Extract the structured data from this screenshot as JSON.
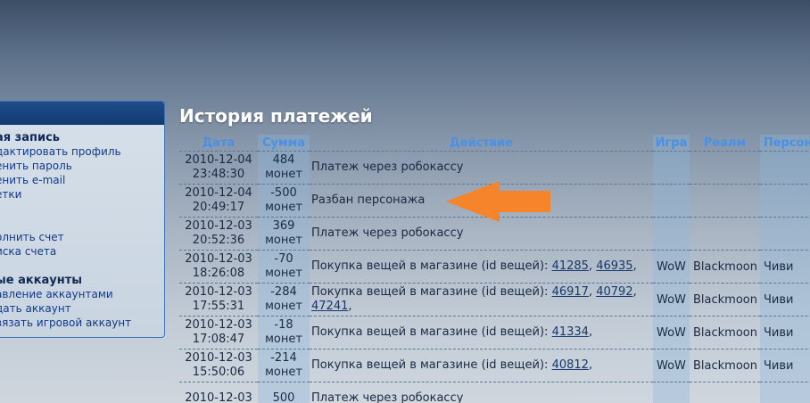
{
  "sidebar": {
    "sections": [
      {
        "title": "ая запись",
        "links": [
          "дактировать профиль",
          "енить пароль",
          "енить e-mail",
          "етки"
        ]
      },
      {
        "title": "",
        "links": [
          "олнить счет",
          "иска счета"
        ]
      },
      {
        "title": "ые аккаунты",
        "links": [
          "авление аккаунтами",
          "дать аккаунт",
          "вязать игровой аккаунт"
        ]
      }
    ]
  },
  "page_title": "История платежей",
  "table": {
    "headers": {
      "date": "Дата",
      "amount": "Сумма",
      "action": "Действие",
      "game": "Игра",
      "realm": "Реалм",
      "character": "Персонаж"
    },
    "rows": [
      {
        "date": "2010-12-04",
        "time": "23:48:30",
        "amount": "484",
        "unit": "монет",
        "action": "Платеж через робокассу",
        "items": [],
        "game": "",
        "realm": "",
        "character": ""
      },
      {
        "date": "2010-12-04",
        "time": "20:49:17",
        "amount": "-500",
        "unit": "монет",
        "action": "Разбан персонажа",
        "items": [],
        "game": "",
        "realm": "",
        "character": ""
      },
      {
        "date": "2010-12-03",
        "time": "20:52:36",
        "amount": "369",
        "unit": "монет",
        "action": "Платеж через робокассу",
        "items": [],
        "game": "",
        "realm": "",
        "character": ""
      },
      {
        "date": "2010-12-03",
        "time": "18:26:08",
        "amount": "-70",
        "unit": "монет",
        "action": "Покупка вещей в магазине (id вещей): ",
        "items": [
          "41285",
          "46935"
        ],
        "game": "WoW",
        "realm": "Blackmoon",
        "character": "Чиви"
      },
      {
        "date": "2010-12-03",
        "time": "17:55:31",
        "amount": "-284",
        "unit": "монет",
        "action": "Покупка вещей в магазине (id вещей): ",
        "items": [
          "46917",
          "40792",
          "47241"
        ],
        "game": "WoW",
        "realm": "Blackmoon",
        "character": "Чиви"
      },
      {
        "date": "2010-12-03",
        "time": "17:08:47",
        "amount": "-18",
        "unit": "монет",
        "action": "Покупка вещей в магазине (id вещей): ",
        "items": [
          "41334"
        ],
        "game": "WoW",
        "realm": "Blackmoon",
        "character": "Чиви"
      },
      {
        "date": "2010-12-03",
        "time": "15:50:06",
        "amount": "-214",
        "unit": "монет",
        "action": "Покупка вещей в магазине (id вещей): ",
        "items": [
          "40812"
        ],
        "game": "WoW",
        "realm": "Blackmoon",
        "character": "Чиви"
      },
      {
        "date": "2010-12-03",
        "time": "",
        "amount": "500",
        "unit": "",
        "action": "Платеж через робокассу",
        "items": [],
        "game": "",
        "realm": "",
        "character": ""
      }
    ]
  },
  "arrow": {
    "color": "#f5842a",
    "icon": "left-arrow-icon"
  }
}
